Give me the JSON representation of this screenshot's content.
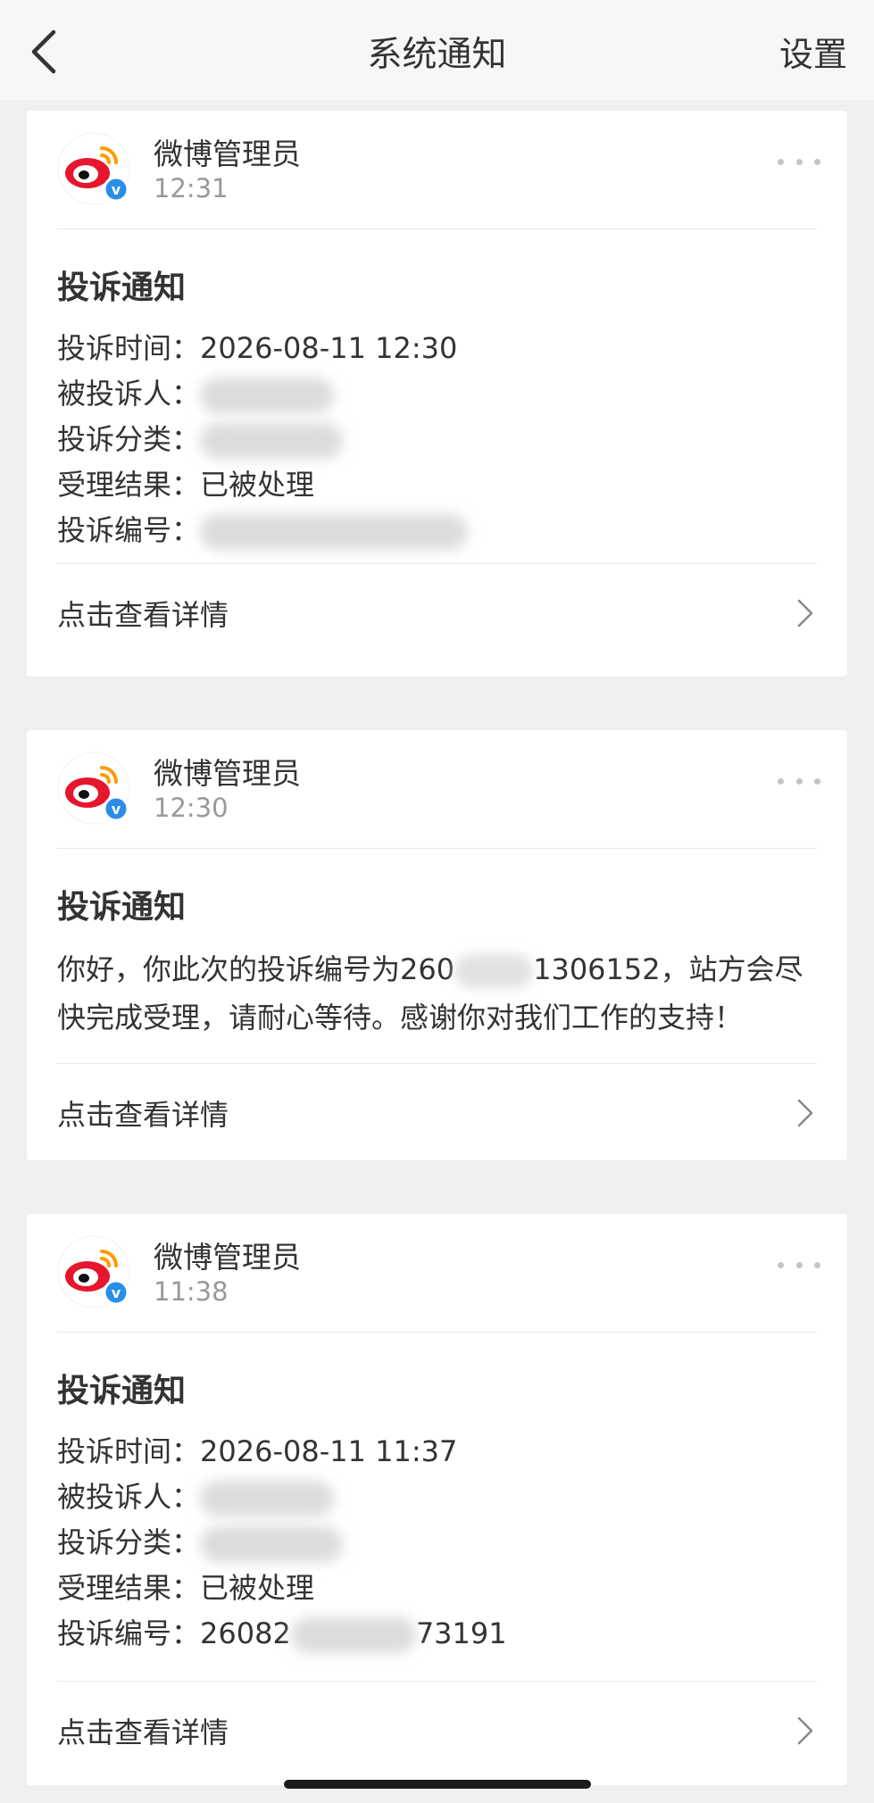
{
  "header": {
    "title": "系统通知",
    "settings_label": "设置",
    "back_icon": "chevron-left-icon"
  },
  "cards": [
    {
      "sender": "微博管理员",
      "time": "12:31",
      "title": "投诉通知",
      "fields": [
        {
          "label": "投诉时间：",
          "value": "2026-08-11 12:30"
        },
        {
          "label": "被投诉人：",
          "value": ""
        },
        {
          "label": "投诉分类：",
          "value": ""
        },
        {
          "label": "受理结果：",
          "value": "已被处理"
        },
        {
          "label": "投诉编号：",
          "value": ""
        }
      ],
      "link": "点击查看详情"
    },
    {
      "sender": "微博管理员",
      "time": "12:30",
      "title": "投诉通知",
      "message_before": "你好，你此次的投诉编号为260",
      "message_after": "1306152，站方会尽快完成受理，请耐心等待。感谢你对我们工作的支持！",
      "link": "点击查看详情"
    },
    {
      "sender": "微博管理员",
      "time": "11:38",
      "title": "投诉通知",
      "fields": [
        {
          "label": "投诉时间：",
          "value": "2026-08-11 11:37"
        },
        {
          "label": "被投诉人：",
          "value": ""
        },
        {
          "label": "投诉分类：",
          "value": ""
        },
        {
          "label": "受理结果：",
          "value": "已被处理"
        },
        {
          "label": "投诉编号：",
          "value": "26082",
          "value_tail": "73191"
        }
      ],
      "link": "点击查看详情"
    }
  ],
  "colors": {
    "background": "#efefef",
    "card": "#ffffff",
    "weibo_red": "#e6162d",
    "weibo_orange": "#ff9b00",
    "verified_blue": "#2a8ee8"
  }
}
